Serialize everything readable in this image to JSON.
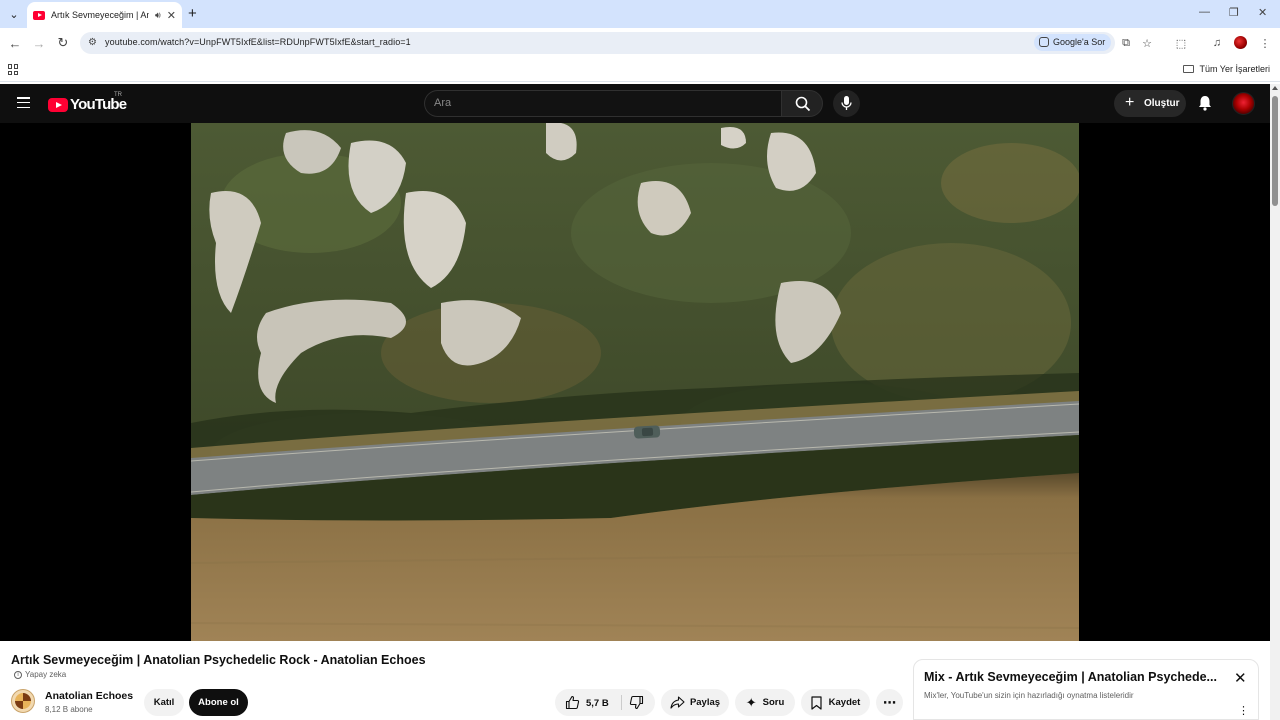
{
  "browser": {
    "tab_title": "Artık Sevmeyeceğim | Anat",
    "new_tab_label": "+",
    "url": "youtube.com/watch?v=UnpFWT5IxfE&list=RDUnpFWT5IxfE&start_radio=1",
    "ask_google_label": "Google'a Sor",
    "all_bookmarks_label": "Tüm Yer İşaretleri"
  },
  "youtube": {
    "logo_text": "YouTube",
    "country_code": "TR",
    "search_placeholder": "Ara",
    "create_label": "Oluştur"
  },
  "video": {
    "title": "Artık Sevmeyeceğim | Anatolian Psychedelic Rock - Anatolian Echoes",
    "ai_tag": "Yapay zeka",
    "channel_name": "Anatolian Echoes",
    "subscribers": "8,12 B abone",
    "join_label": "Katıl",
    "subscribe_label": "Abone ol",
    "likes": "5,7 B",
    "share_label": "Paylaş",
    "ask_label": "Soru",
    "save_label": "Kaydet"
  },
  "mix": {
    "title": "Mix - Artık Sevmeyeceğim | Anatolian Psychede...",
    "subtitle": "Mix'ler, YouTube'un sizin için hazırladığı oynatma listeleridir"
  },
  "colors": {
    "youtube_red": "#ff0033",
    "header_bg": "#0f0f0f",
    "chrome_tabstrip": "#d3e3fd"
  }
}
